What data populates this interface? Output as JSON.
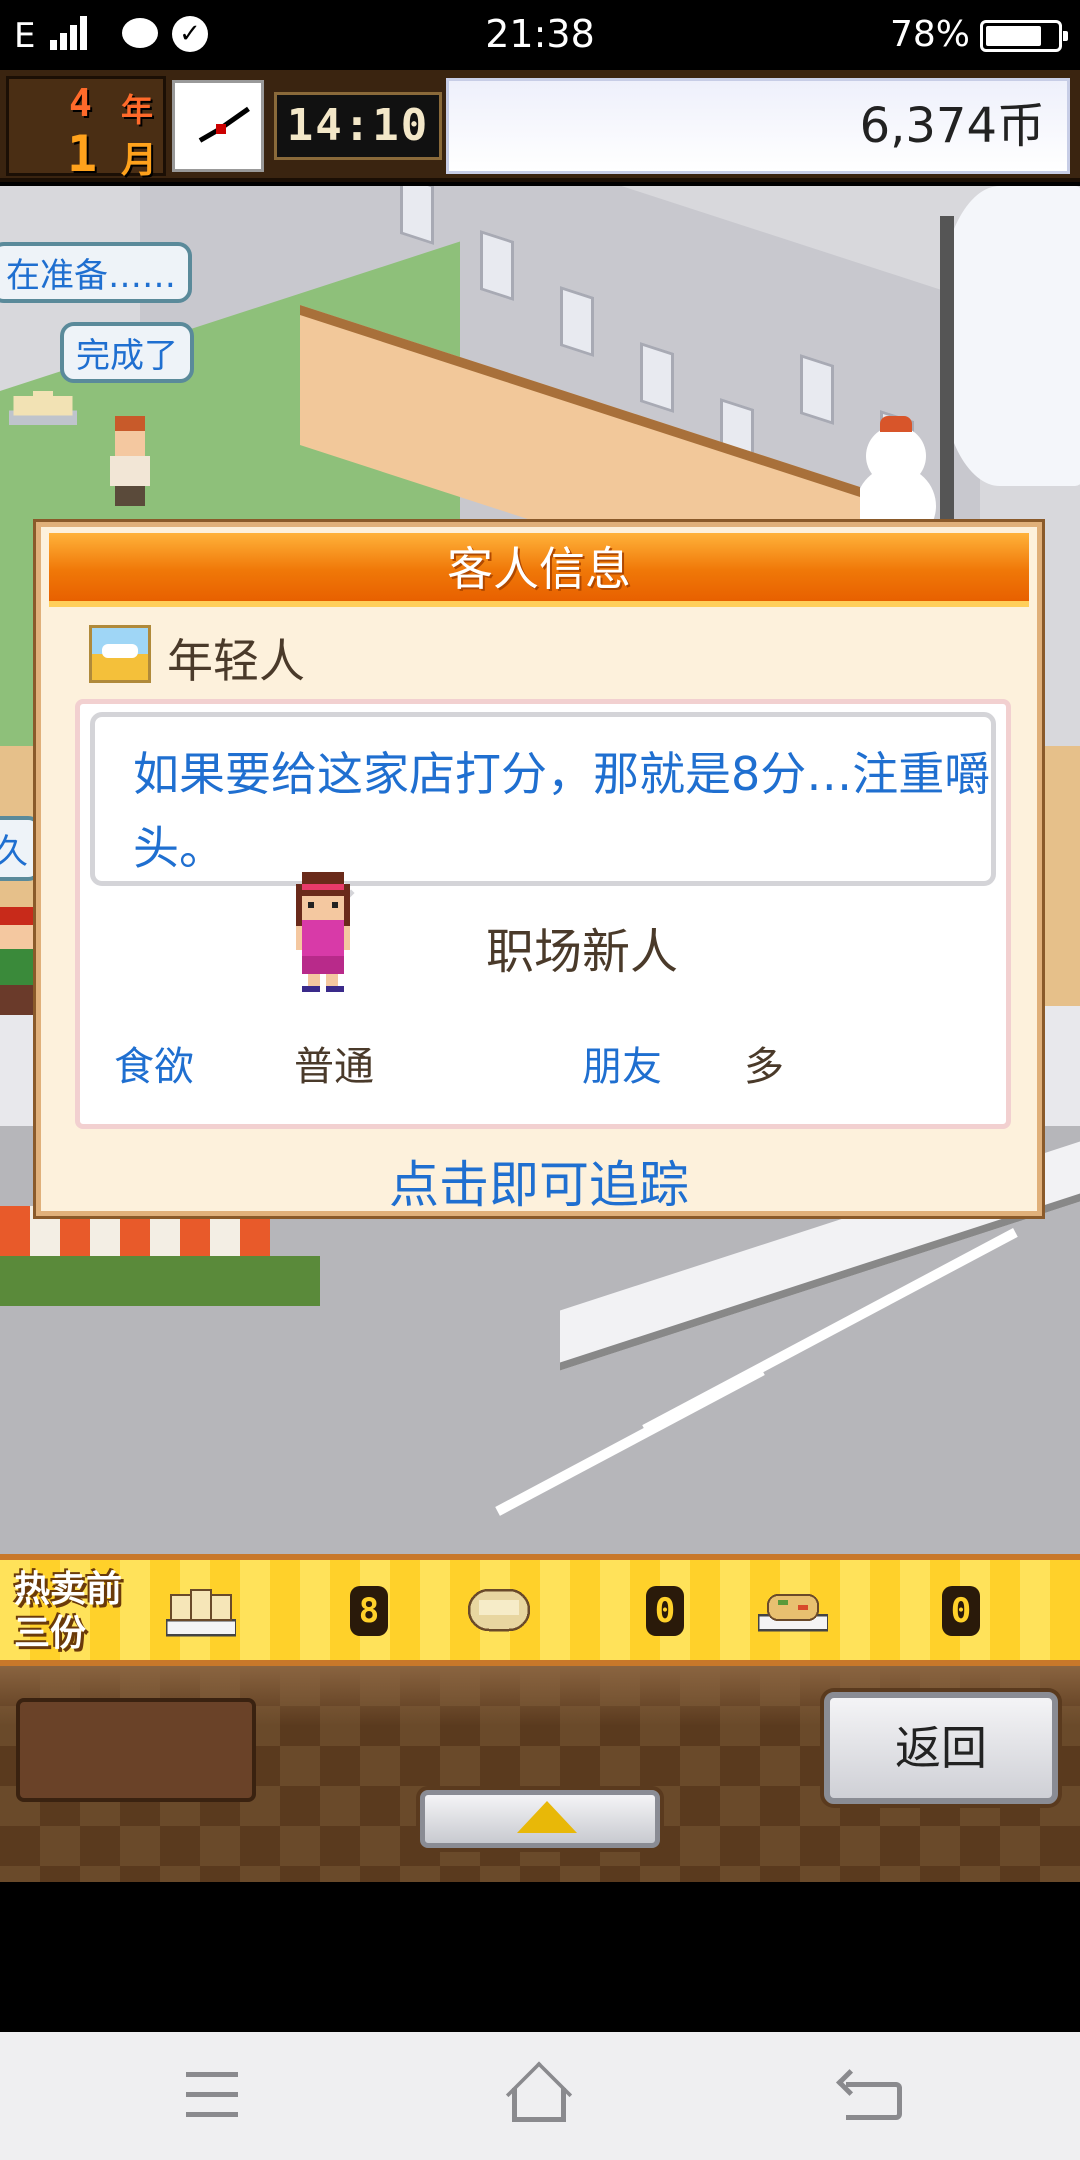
{
  "status_bar": {
    "network": "E",
    "time": "21:38",
    "battery": "78%"
  },
  "hud": {
    "year_num": "4",
    "year_label": "年",
    "month_num": "1",
    "month_label": "月",
    "game_time": "14:10",
    "money": "6,374币"
  },
  "world": {
    "speech_preparing": "在准备……",
    "speech_done": "完成了",
    "speech_edge": "久"
  },
  "dialog": {
    "title": "客人信息",
    "customer_type": "年轻人",
    "quote": "如果要给这家店打分，那就是8分…注重嚼头。",
    "occupation": "职场新人",
    "stats": [
      {
        "label": "食欲",
        "value": "普通"
      },
      {
        "label": "朋友",
        "value": "多"
      }
    ],
    "track_link": "点击即可追踪"
  },
  "best_sellers": {
    "title": "热卖前三份",
    "items": [
      {
        "icon": "dumpling-plate-icon",
        "count": "8"
      },
      {
        "icon": "rice-bowl-icon",
        "count": "0"
      },
      {
        "icon": "fried-rice-plate-icon",
        "count": "0"
      }
    ]
  },
  "controls": {
    "back_label": "返回"
  },
  "colors": {
    "accent_orange": "#f07808",
    "text_blue": "#1f6fd0",
    "dialog_bg": "#fdf1dc"
  }
}
